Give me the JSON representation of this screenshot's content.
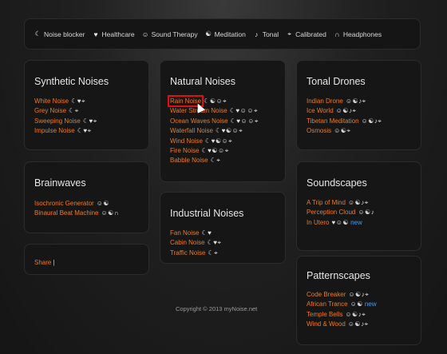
{
  "topbar": {
    "categories": [
      {
        "label": "Noise blocker",
        "icon": "☾"
      },
      {
        "label": "Healthcare",
        "icon": "♥"
      },
      {
        "label": "Sound Therapy",
        "icon": "☺"
      },
      {
        "label": "Meditation",
        "icon": "☯"
      },
      {
        "label": "Tonal",
        "icon": "♪"
      },
      {
        "label": "Calibrated",
        "icon": "⌖"
      },
      {
        "label": "Headphones",
        "icon": "∩"
      }
    ]
  },
  "synthetic": {
    "title": "Synthetic Noises",
    "items": [
      {
        "label": "White Noise",
        "icons": "☾♥⌖"
      },
      {
        "label": "Grey Noise",
        "icons": "☾⌖"
      },
      {
        "label": "Sweeping Noise",
        "icons": "☾♥⌖"
      },
      {
        "label": "Impulse Noise",
        "icons": "☾♥⌖"
      }
    ]
  },
  "natural": {
    "title": "Natural Noises",
    "items": [
      {
        "label": "Rain Noise",
        "icons": "☾☯☺⌖"
      },
      {
        "label": "Water Stream Noise",
        "icons": "☾♥☺☺⌖"
      },
      {
        "label": "Ocean Waves Noise",
        "icons": "☾♥☺☺⌖"
      },
      {
        "label": "Waterfall Noise",
        "icons": "☾♥☯☺⌖"
      },
      {
        "label": "Wind Noise",
        "icons": "☾♥☯☺⌖"
      },
      {
        "label": "Fire Noise",
        "icons": "☾♥☯☺⌖"
      },
      {
        "label": "Babble Noise",
        "icons": "☾⌖"
      }
    ]
  },
  "tonal": {
    "title": "Tonal Drones",
    "items": [
      {
        "label": "Indian Drone",
        "icons": "☺☯♪⌖"
      },
      {
        "label": "Ice World",
        "icons": "☺☯♪⌖"
      },
      {
        "label": "Tibetan Meditation",
        "icons": "☺☯♪⌖"
      },
      {
        "label": "Osmosis",
        "icons": "☺☯⌖"
      }
    ]
  },
  "brainwaves": {
    "title": "Brainwaves",
    "items": [
      {
        "label": "Isochronic Generator",
        "icons": "☺☯"
      },
      {
        "label": "Binaural Beat Machine",
        "icons": "☺☯∩"
      }
    ]
  },
  "industrial": {
    "title": "Industrial Noises",
    "items": [
      {
        "label": "Fan Noise",
        "icons": "☾♥"
      },
      {
        "label": "Cabin Noise",
        "icons": "☾♥⌖"
      },
      {
        "label": "Traffic Noise",
        "icons": "☾⌖"
      }
    ]
  },
  "soundscapes": {
    "title": "Soundscapes",
    "items": [
      {
        "label": "A Trip of Mind",
        "icons": "☺☯♪⌖",
        "badge": ""
      },
      {
        "label": "Perception Cloud",
        "icons": "☺☯♪",
        "badge": ""
      },
      {
        "label": "In Utero",
        "icons": "♥☺☯",
        "badge": "new"
      }
    ]
  },
  "patternscapes": {
    "title": "Patternscapes",
    "items": [
      {
        "label": "Code Breaker",
        "icons": "☺☯♪⌖",
        "badge": ""
      },
      {
        "label": "African Trance",
        "icons": "☺☯",
        "badge": "new"
      },
      {
        "label": "Temple Bells",
        "icons": "☺☯♪⌖",
        "badge": ""
      },
      {
        "label": "Wind & Wood",
        "icons": "☺☯♪⌖",
        "badge": ""
      }
    ]
  },
  "share": {
    "label": "Share",
    "sep": "|"
  },
  "footer": {
    "copyright": "Copyright © 2013 myNoise.net"
  },
  "colors": {
    "link": "#f07a1a",
    "new_badge": "#4a9ae8",
    "highlight": "#e01010"
  }
}
